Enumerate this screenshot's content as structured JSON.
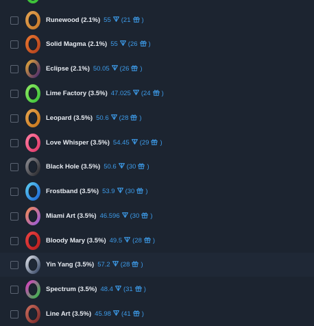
{
  "items": [
    {
      "name": "Runewood (2.1%)",
      "price": "55",
      "count": "21",
      "color": "#c87a2a",
      "color2": "#e0a050",
      "checked": false
    },
    {
      "name": "Solid Magma (2.1%)",
      "price": "55",
      "count": "26",
      "color": "#b4421e",
      "color2": "#e7742e",
      "checked": false
    },
    {
      "name": "Eclipse (2.1%)",
      "price": "50.05",
      "count": "26",
      "color": "#4a2a6e",
      "color2": "#e0a43a",
      "checked": false
    },
    {
      "name": "Lime Factory (3.5%)",
      "price": "47.025",
      "count": "24",
      "color": "#3ec23a",
      "color2": "#8ae860",
      "checked": false
    },
    {
      "name": "Leopard (3.5%)",
      "price": "50.6",
      "count": "28",
      "color": "#c8781e",
      "color2": "#e6a24a",
      "checked": false
    },
    {
      "name": "Love Whisper (3.5%)",
      "price": "54.45",
      "count": "29",
      "color": "#e03a6a",
      "color2": "#ff7aa0",
      "checked": false
    },
    {
      "name": "Black Hole (3.5%)",
      "price": "50.6",
      "count": "30",
      "color": "#2a2a2e",
      "color2": "#8a8a90",
      "checked": false
    },
    {
      "name": "Frostband (3.5%)",
      "price": "53.9",
      "count": "30",
      "color": "#1e6ad8",
      "color2": "#5ac8f0",
      "checked": false
    },
    {
      "name": "Miami Art (3.5%)",
      "price": "46.596",
      "count": "30",
      "color": "#9a5ad8",
      "color2": "#f08a5a",
      "checked": false
    },
    {
      "name": "Bloody Mary (3.5%)",
      "price": "49.5",
      "count": "28",
      "color": "#b81e1e",
      "color2": "#e84040",
      "checked": false
    },
    {
      "name": "Yin Yang (3.5%)",
      "price": "57.2",
      "count": "28",
      "color": "#3a4a68",
      "color2": "#d8dce4",
      "checked": false
    },
    {
      "name": "Spectrum (3.5%)",
      "price": "48.4",
      "count": "31",
      "color": "#38b848",
      "color2": "#d840c0",
      "checked": false
    },
    {
      "name": "Line Art (3.5%)",
      "price": "45.98",
      "count": "41",
      "color": "#7a2a2a",
      "color2": "#c86a5a",
      "checked": false
    }
  ],
  "icons": {
    "currency": "ton-diamond-icon",
    "gift": "gift-icon"
  },
  "colors": {
    "background": "#1c2430",
    "highlight_row": "#1f2836",
    "name_text": "#e8ecf2",
    "price_text": "#3d9be9"
  }
}
